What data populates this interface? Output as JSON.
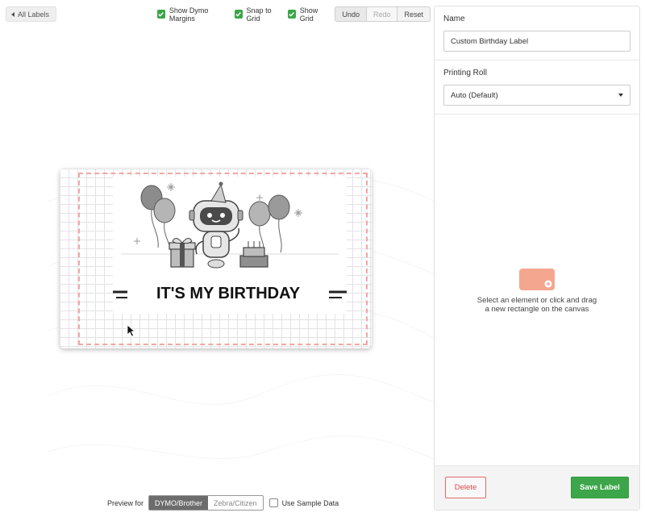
{
  "nav": {
    "back_label": "All Labels"
  },
  "toolbar": {
    "show_margins_label": "Show Dymo Margins",
    "snap_label": "Snap to Grid",
    "show_grid_label": "Show Grid",
    "undo_label": "Undo",
    "redo_label": "Redo",
    "reset_label": "Reset"
  },
  "canvas": {
    "birthday_text": "IT'S MY BIRTHDAY"
  },
  "preview": {
    "label": "Preview for",
    "options": [
      "DYMO/Brother",
      "Zebra/Citizen"
    ],
    "selected": "DYMO/Brother",
    "sample_data_label": "Use Sample Data"
  },
  "panel": {
    "name_title": "Name",
    "name_value": "Custom Birthday Label",
    "roll_title": "Printing Roll",
    "roll_value": "Auto (Default)",
    "empty_line1": "Select an element or click and drag",
    "empty_line2": "a new rectangle on the canvas",
    "delete_label": "Delete",
    "save_label": "Save Label"
  },
  "colors": {
    "accent_green": "#3ea64a",
    "danger_red": "#d84a4a",
    "margin_pink": "#f2a6a6",
    "placeholder_icon": "#f4a68f"
  }
}
